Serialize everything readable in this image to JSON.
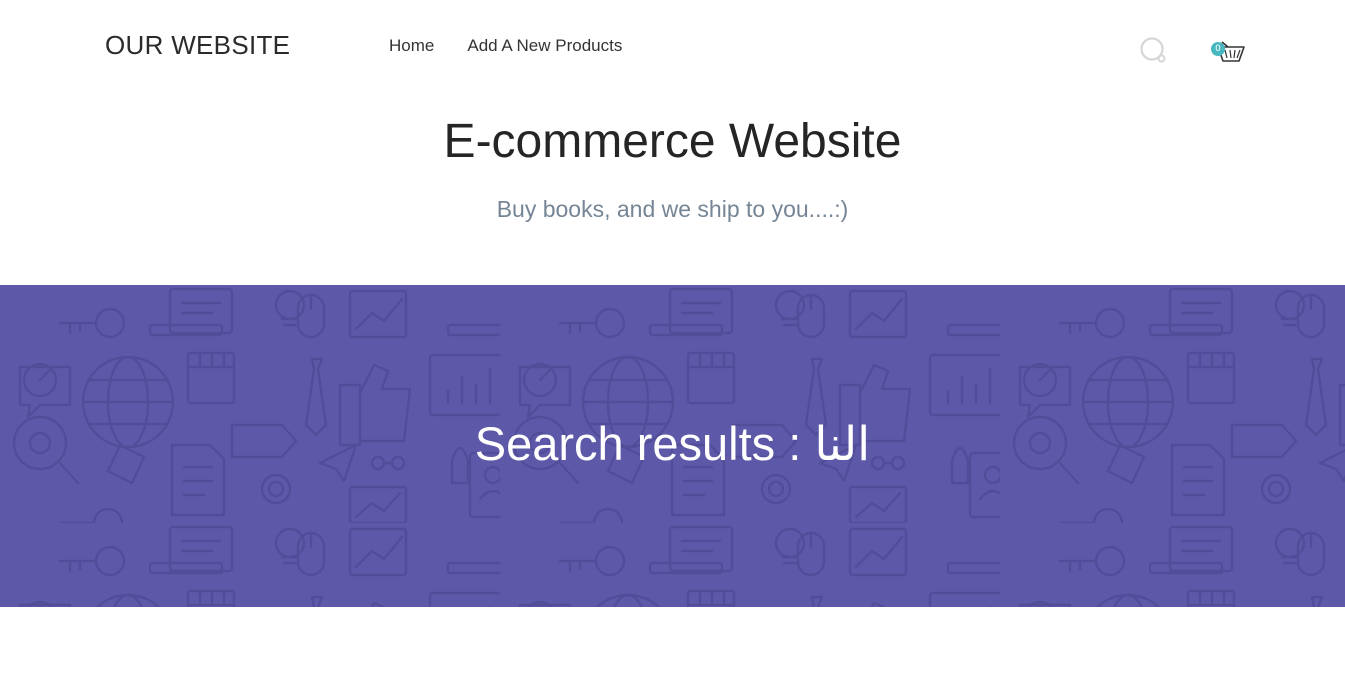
{
  "header": {
    "logo": "OUR WEBSITE",
    "nav": [
      {
        "label": "Home"
      },
      {
        "label": "Add A New Products"
      }
    ],
    "cart_count": "0"
  },
  "intro": {
    "title": "E-commerce Website",
    "subtitle": "Buy books, and we ship to you....:)"
  },
  "banner": {
    "prefix": "Search results : ",
    "query": "النا",
    "background_color": "#5d59a8"
  }
}
